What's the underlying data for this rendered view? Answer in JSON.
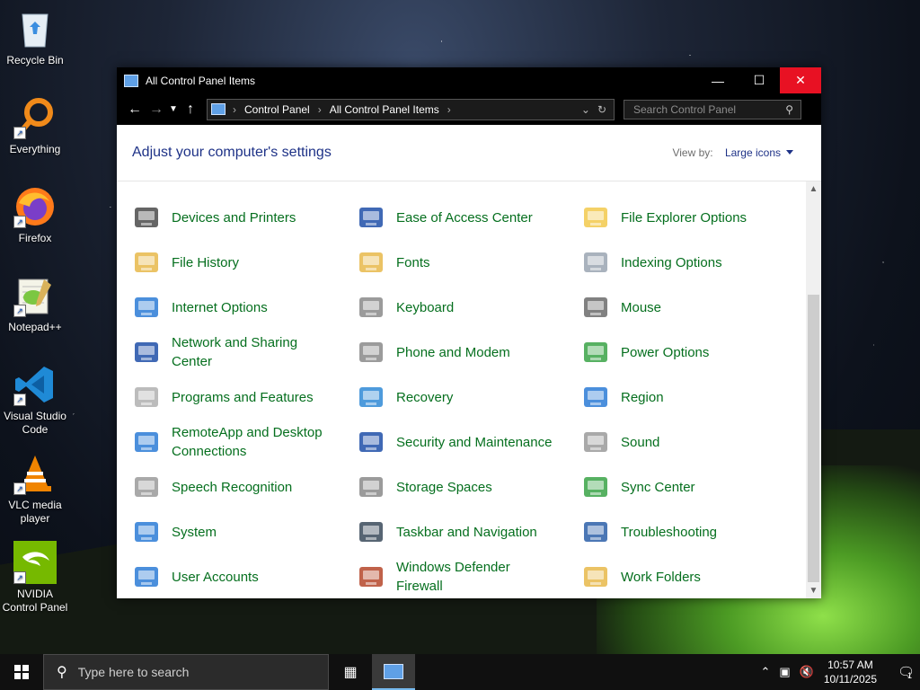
{
  "desktop": {
    "icons": [
      {
        "label": "Recycle Bin"
      },
      {
        "label": "Everything"
      },
      {
        "label": "Firefox"
      },
      {
        "label": "Notepad++"
      },
      {
        "label": "Visual Studio Code"
      },
      {
        "label": "VLC media player"
      },
      {
        "label": "NVIDIA Control Panel"
      }
    ]
  },
  "window": {
    "title": "All Control Panel Items",
    "address": {
      "crumbs": [
        "Control Panel",
        "All Control Panel Items"
      ]
    },
    "search_placeholder": "Search Control Panel",
    "heading": "Adjust your computer's settings",
    "view_by_label": "View by:",
    "view_by_value": "Large icons",
    "items": [
      {
        "label": "Devices and Printers",
        "icon": "printer-icon"
      },
      {
        "label": "Ease of Access Center",
        "icon": "ease-of-access-icon"
      },
      {
        "label": "File Explorer Options",
        "icon": "folder-options-icon"
      },
      {
        "label": "File History",
        "icon": "file-history-icon"
      },
      {
        "label": "Fonts",
        "icon": "fonts-icon"
      },
      {
        "label": "Indexing Options",
        "icon": "indexing-icon"
      },
      {
        "label": "Internet Options",
        "icon": "internet-options-icon"
      },
      {
        "label": "Keyboard",
        "icon": "keyboard-icon"
      },
      {
        "label": "Mouse",
        "icon": "mouse-icon"
      },
      {
        "label": "Network and Sharing Center",
        "icon": "network-icon"
      },
      {
        "label": "Phone and Modem",
        "icon": "phone-icon"
      },
      {
        "label": "Power Options",
        "icon": "power-icon"
      },
      {
        "label": "Programs and Features",
        "icon": "programs-icon"
      },
      {
        "label": "Recovery",
        "icon": "recovery-icon"
      },
      {
        "label": "Region",
        "icon": "region-icon"
      },
      {
        "label": "RemoteApp and Desktop Connections",
        "icon": "remoteapp-icon"
      },
      {
        "label": "Security and Maintenance",
        "icon": "security-flag-icon"
      },
      {
        "label": "Sound",
        "icon": "sound-icon"
      },
      {
        "label": "Speech Recognition",
        "icon": "microphone-icon"
      },
      {
        "label": "Storage Spaces",
        "icon": "storage-icon"
      },
      {
        "label": "Sync Center",
        "icon": "sync-icon"
      },
      {
        "label": "System",
        "icon": "system-icon"
      },
      {
        "label": "Taskbar and Navigation",
        "icon": "taskbar-icon"
      },
      {
        "label": "Troubleshooting",
        "icon": "troubleshooting-icon"
      },
      {
        "label": "User Accounts",
        "icon": "user-accounts-icon"
      },
      {
        "label": "Windows Defender Firewall",
        "icon": "firewall-icon"
      },
      {
        "label": "Work Folders",
        "icon": "work-folders-icon"
      }
    ]
  },
  "taskbar": {
    "search_placeholder": "Type here to search",
    "time": "10:57 AM",
    "date": "10/11/2025",
    "notification_count": "1"
  },
  "colors": {
    "link_green": "#056f1e",
    "heading_blue": "#1e3287",
    "close_red": "#e81123"
  }
}
